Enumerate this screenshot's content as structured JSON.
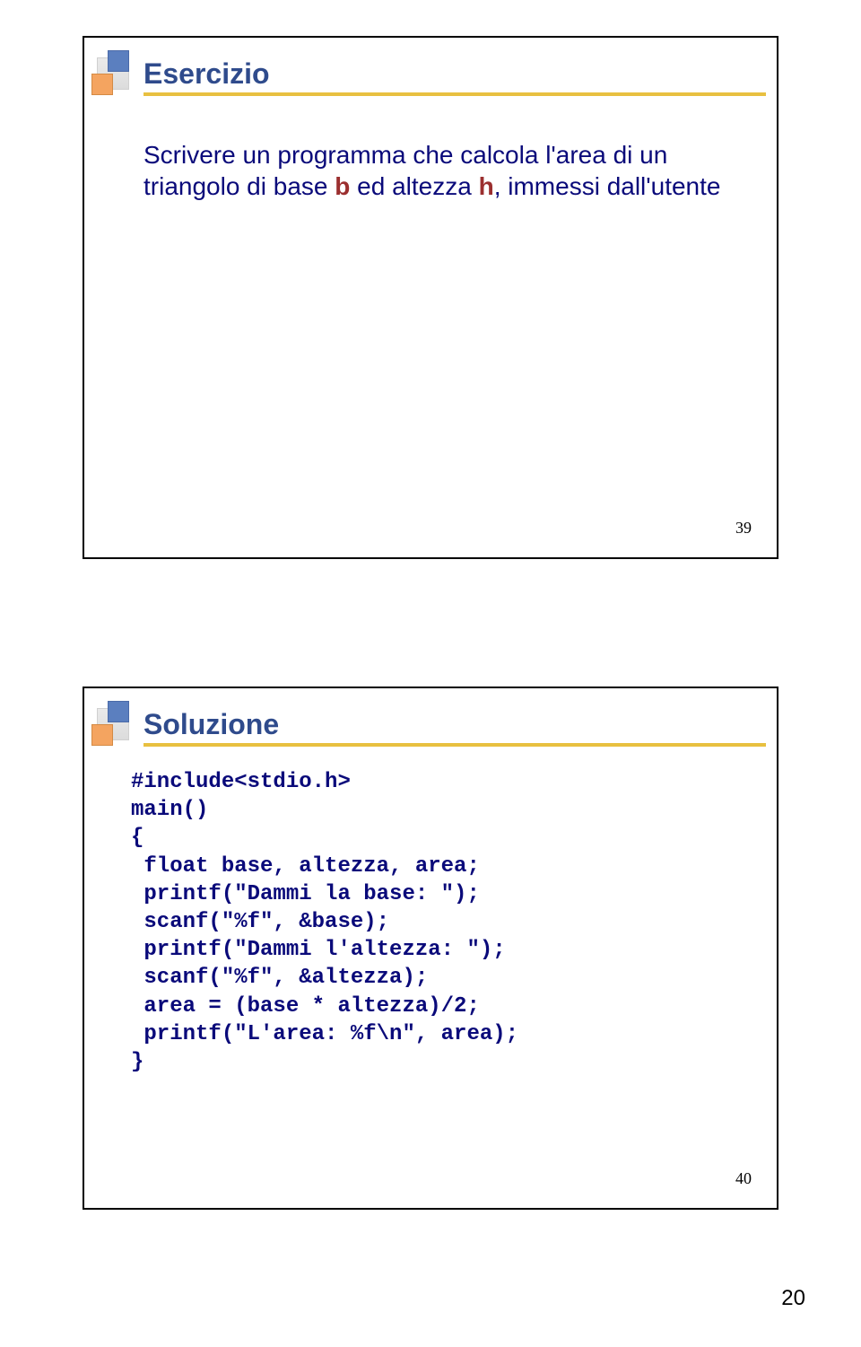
{
  "slide1": {
    "title": "Esercizio",
    "body_part1": "Scrivere un programma che calcola l'area di un triangolo di base ",
    "b": "b",
    "body_part2": " ed altezza ",
    "h": "h",
    "body_part3": ", immessi dall'utente",
    "num": "39"
  },
  "slide2": {
    "title": "Soluzione",
    "code": "#include<stdio.h>\nmain()\n{\n float base, altezza, area;\n printf(\"Dammi la base: \");\n scanf(\"%f\", &base);\n printf(\"Dammi l'altezza: \");\n scanf(\"%f\", &altezza);\n area = (base * altezza)/2;\n printf(\"L'area: %f\\n\", area);\n}",
    "num": "40"
  },
  "page_num": "20"
}
